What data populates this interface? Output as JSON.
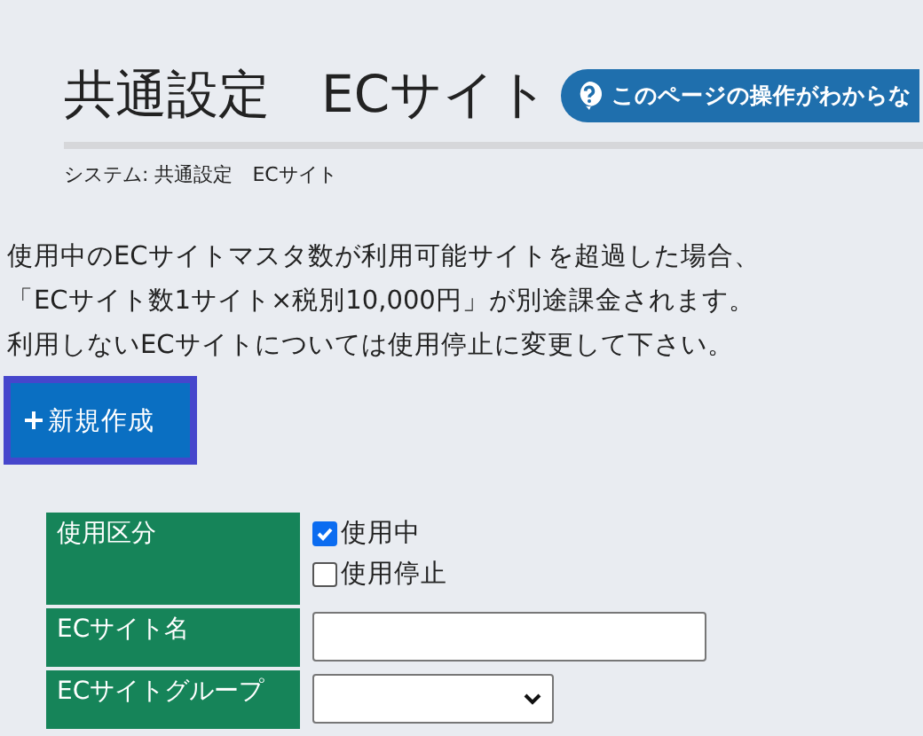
{
  "header": {
    "title": "共通設定　ECサイト",
    "help_button": "このページの操作がわからな"
  },
  "breadcrumb": "システム: 共通設定　ECサイト",
  "notice": [
    "使用中のECサイトマスタ数が利用可能サイトを超過した場合、",
    "「ECサイト数1サイト×税別10,000円」が別途課金されます。",
    "利用しないECサイトについては使用停止に変更して下さい。"
  ],
  "new_button": {
    "label": "新規作成",
    "focused": true
  },
  "form": [
    {
      "kind": "checkboxes",
      "label": "使用区分",
      "options": [
        {
          "label": "使用中",
          "checked": true
        },
        {
          "label": "使用停止",
          "checked": false
        }
      ]
    },
    {
      "kind": "text",
      "label": "ECサイト名"
    },
    {
      "kind": "select",
      "label": "ECサイトグループ"
    }
  ]
}
